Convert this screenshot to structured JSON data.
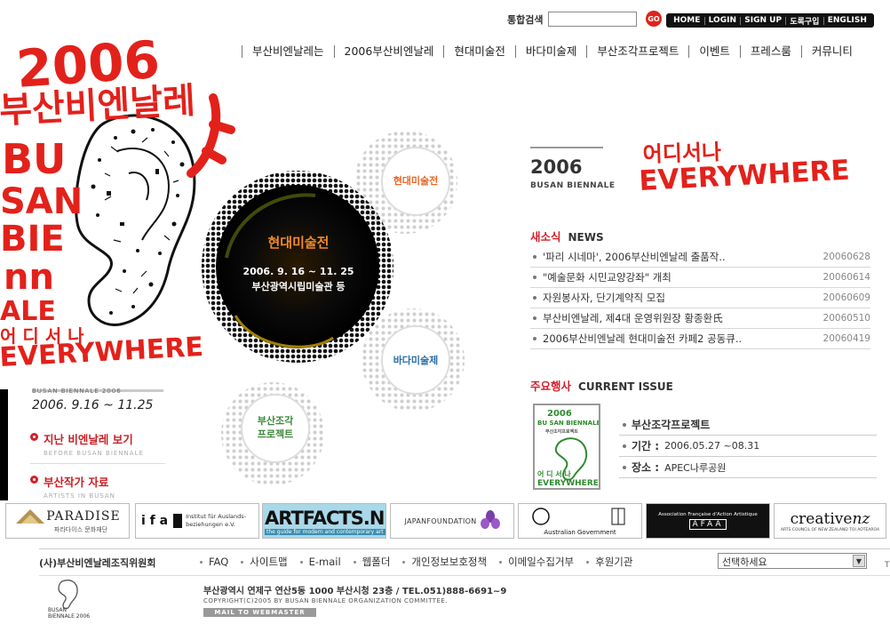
{
  "search": {
    "label": "통합검색",
    "value": "",
    "go": "GO"
  },
  "utility": [
    "HOME",
    "LOGIN",
    "SIGN UP",
    "도록구입",
    "ENGLISH"
  ],
  "nav": [
    "부산비엔날레는",
    "2006부산비엔날레",
    "현대미술전",
    "바다미술제",
    "부산조각프로젝트",
    "이벤트",
    "프레스룸",
    "커뮤니티"
  ],
  "logo": {
    "year": "2006",
    "korean": "부산비엔날레",
    "latin": [
      "BU",
      "SAN",
      "BIE",
      "nn",
      "ALE"
    ],
    "slogan_k": "어 디 서 나",
    "slogan_e": "EVERYWHERE"
  },
  "left_info": {
    "subtitle": "BUSAN BIENNALE 2006",
    "dates": "2006. 9.16 ~ 11.25"
  },
  "quick_links": [
    {
      "label": "지난 비엔날레 보기",
      "sub": "BEFORE BUSAN BIENNALE"
    },
    {
      "label": "부산작가 자료",
      "sub": "ARTISTS IN BUSAN"
    }
  ],
  "circles": {
    "main_title": "현대미술전",
    "main_dates": "2006. 9. 16 ~ 11. 25",
    "main_venue": "부산광역시립미술관 등",
    "contemporary": "현대미술전",
    "sea": "바다미술제",
    "sculpture": [
      "부산조각",
      "프로젝트"
    ]
  },
  "right_title": {
    "year": "2006",
    "name": "BUSAN BIENNALE",
    "slogan_k": "어디서나",
    "slogan_e": "EVERYWHERE"
  },
  "news": {
    "title_k": "새소식",
    "title_e": "NEWS",
    "items": [
      {
        "title": "'파리 시네마', 2006부산비엔날레 출품작..",
        "date": "20060628"
      },
      {
        "title": "\"예술문화 시민교양강좌\" 개최",
        "date": "20060614"
      },
      {
        "title": "자원봉사자, 단기계약직 모집",
        "date": "20060609"
      },
      {
        "title": "부산비엔날레, 제4대 운영위원장 황종환氏",
        "date": "20060510"
      },
      {
        "title": "2006부산비엔날레 현대미술전 카페2 공동큐..",
        "date": "20060419"
      }
    ]
  },
  "issue": {
    "title_k": "주요행사",
    "title_e": "CURRENT ISSUE",
    "thumb": {
      "year": "2006",
      "name": "BU SAN BIENNALE",
      "sub": "부산조각프로젝트",
      "slogan_k": "어 디 서 나",
      "slogan_e": "EVERYWHERE"
    },
    "name": "부산조각프로젝트",
    "period_label": "기간 :",
    "period": "2006.05.27 ~08.31",
    "place_label": "장소 :",
    "place": "APEC나루공원"
  },
  "sponsors": {
    "paradise": "PARADISE",
    "paradise_sub": "파라다이스 문화재단",
    "ifa": "i f a",
    "ifa_sub": "Institut für Auslands-\nbeziehungen e.V.",
    "artfacts": "ARTFACTS.NET",
    "artfacts_sub": "the guide for modern and contemporary art",
    "japan": "JAPANFOUNDATION",
    "australia": "Australian Government",
    "afaa": "AFAA",
    "afaa_sub": "Association Française d'Action Artistique",
    "creative": "creative",
    "creative2": "nz",
    "creative_sub": "ARTS COUNCIL OF NEW ZEALAND TOI AOTEAROA"
  },
  "footer": {
    "org": "(사)부산비엔날레조직위원회",
    "links": [
      "FAQ",
      "사이트맵",
      "E-mail",
      "웹폴더",
      "개인정보보호정책",
      "이메일수집거부",
      "후원기관"
    ],
    "select": "선택하세요",
    "corner": "T",
    "address": "부산광역시 연제구 연산5동 1000 부산시청 23층  /  TEL.051)888-6691~9",
    "copyright": "COPYRIGHT(C)2005 BY BUSAN BIENNALE ORGANIZATION COMMITTEE.",
    "mail": "MAIL TO WEBMASTER",
    "logo_text": [
      "BUSAN",
      "BIENNALE 2006"
    ]
  },
  "colors": {
    "accent": "#d4202a",
    "black": "#111111",
    "orange": "#e8672a",
    "blue": "#2b6ea8",
    "green": "#3c8a3c"
  }
}
